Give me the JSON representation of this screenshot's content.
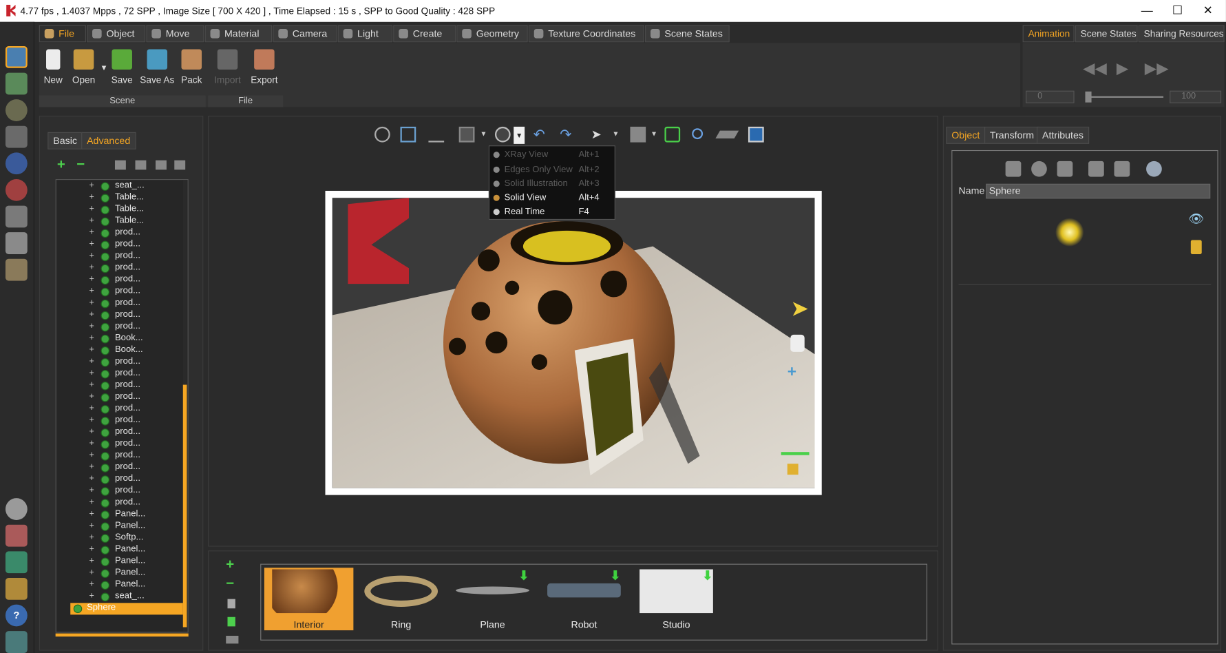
{
  "titlebar": {
    "text": "4.77 fps ,  1.4037 Mpps  ,  72 SPP    ,  Image Size [ 700 X 420 ]  , Time Elapsed : 15 s , SPP to Good Quality : 428 SPP",
    "min": "—",
    "max": "☐",
    "close": "✕"
  },
  "menu_tabs": [
    {
      "label": "File"
    },
    {
      "label": "Object"
    },
    {
      "label": "Move"
    },
    {
      "label": "Material"
    },
    {
      "label": "Camera"
    },
    {
      "label": "Light"
    },
    {
      "label": "Create"
    },
    {
      "label": "Geometry"
    },
    {
      "label": "Texture Coordinates"
    },
    {
      "label": "Scene States"
    }
  ],
  "ribbon": {
    "buttons": [
      {
        "label": "New"
      },
      {
        "label": "Open"
      },
      {
        "label": "Save"
      },
      {
        "label": "Save As"
      },
      {
        "label": "Pack"
      },
      {
        "label": "Import"
      },
      {
        "label": "Export"
      }
    ],
    "groups": [
      {
        "label": "Scene"
      },
      {
        "label": "File"
      }
    ]
  },
  "right_tabs": [
    {
      "label": "Animation"
    },
    {
      "label": "Scene States"
    },
    {
      "label": "Sharing Resources"
    }
  ],
  "animation": {
    "start": "0",
    "end": "100"
  },
  "left_panel": {
    "tabs": [
      {
        "label": "Basic"
      },
      {
        "label": "Advanced"
      }
    ],
    "add": "+",
    "remove": "−"
  },
  "tree_items": [
    "seat_...",
    "Table...",
    "Table...",
    "Table...",
    "prod...",
    "prod...",
    "prod...",
    "prod...",
    "prod...",
    "prod...",
    "prod...",
    "prod...",
    "prod...",
    "Book...",
    "Book...",
    "prod...",
    "prod...",
    "prod...",
    "prod...",
    "prod...",
    "prod...",
    "prod...",
    "prod...",
    "prod...",
    "prod...",
    "prod...",
    "prod...",
    "prod...",
    "Panel...",
    "Panel...",
    "Softp...",
    "Panel...",
    "Panel...",
    "Panel...",
    "Panel...",
    "seat_..."
  ],
  "tree_selected": {
    "label": "Sphere"
  },
  "view_menu": {
    "items": [
      {
        "label": "XRay View",
        "shortcut": "Alt+1",
        "enabled": false
      },
      {
        "label": "Edges Only View",
        "shortcut": "Alt+2",
        "enabled": false
      },
      {
        "label": "Solid Illustration",
        "shortcut": "Alt+3",
        "enabled": false
      },
      {
        "label": "Solid View",
        "shortcut": "Alt+4",
        "enabled": true
      },
      {
        "label": "Real Time",
        "shortcut": "F4",
        "enabled": true
      }
    ]
  },
  "gallery": {
    "items": [
      {
        "label": "Interior",
        "selected": true
      },
      {
        "label": "Ring"
      },
      {
        "label": "Plane"
      },
      {
        "label": "Robot"
      },
      {
        "label": "Studio"
      }
    ],
    "add": "+",
    "remove": "−"
  },
  "object_panel": {
    "tabs": [
      {
        "label": "Object"
      },
      {
        "label": "Transform"
      },
      {
        "label": "Attributes"
      }
    ],
    "name_label": "Name",
    "name_value": "Sphere"
  },
  "colors": {
    "accent": "#f5a623",
    "panel": "#2e2e2e",
    "background": "#2b2b2b"
  }
}
